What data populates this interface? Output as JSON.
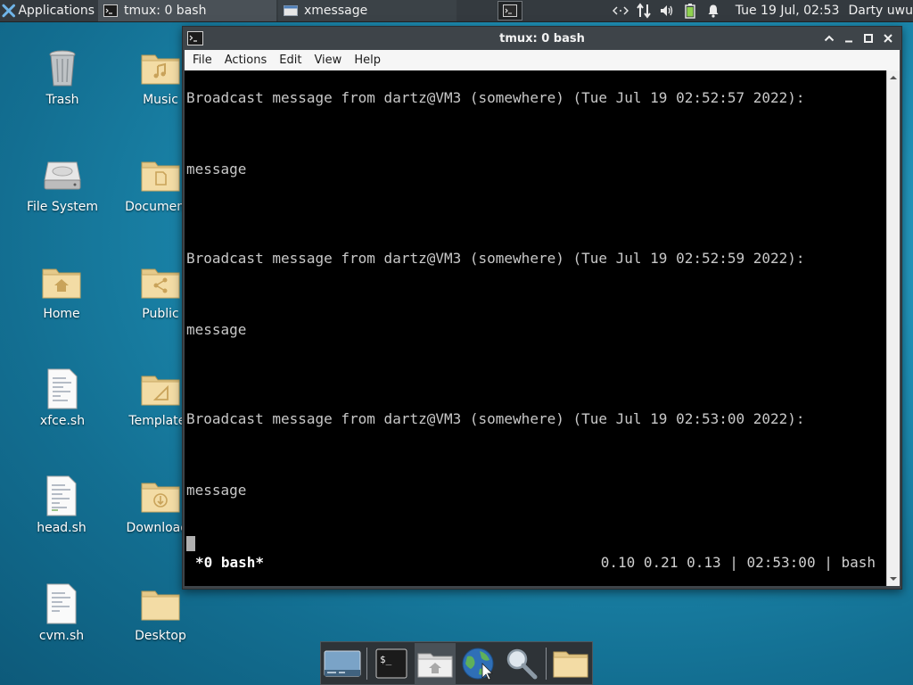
{
  "top_panel": {
    "applications_label": "Applications",
    "tasks": [
      {
        "label": "tmux: 0 bash"
      },
      {
        "label": "xmessage"
      }
    ],
    "clock": "Tue 19 Jul, 02:53",
    "user": "Darty uwu"
  },
  "desktop": {
    "icons": [
      {
        "label": "Trash"
      },
      {
        "label": "Music"
      },
      {
        "label": "File System"
      },
      {
        "label": "Documents"
      },
      {
        "label": "Home"
      },
      {
        "label": "Public"
      },
      {
        "label": "xfce.sh"
      },
      {
        "label": "Templates"
      },
      {
        "label": "head.sh"
      },
      {
        "label": "Downloads"
      },
      {
        "label": "cvm.sh"
      },
      {
        "label": "Desktop"
      }
    ]
  },
  "window": {
    "title": "tmux: 0 bash",
    "menu": [
      "File",
      "Actions",
      "Edit",
      "View",
      "Help"
    ]
  },
  "terminal": {
    "lines": [
      "Broadcast message from dartz@VM3 (somewhere) (Tue Jul 19 02:52:57 2022):",
      "message",
      "Broadcast message from dartz@VM3 (somewhere) (Tue Jul 19 02:52:59 2022):",
      "message",
      "Broadcast message from dartz@VM3 (somewhere) (Tue Jul 19 02:53:00 2022):",
      "message"
    ],
    "status_left": "*0 bash*",
    "status_right": "0.10 0.21 0.13 | 02:53:00 | bash"
  },
  "colors": {
    "panel_bg": "#343a3f",
    "terminal_bg": "#000000",
    "terminal_fg": "#c8c8c8",
    "folder": "#f0d9a0"
  },
  "dock": {
    "items": [
      "show-desktop-icon",
      "terminal-icon",
      "home-folder-icon",
      "web-browser-icon",
      "search-icon",
      "file-manager-icon"
    ]
  }
}
